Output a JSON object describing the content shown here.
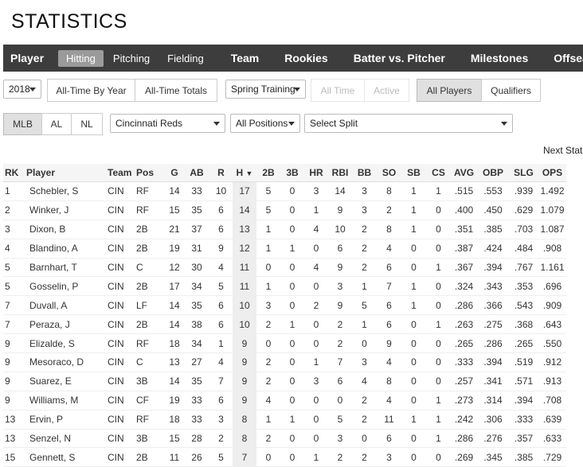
{
  "page": {
    "title": "STATISTICS"
  },
  "nav": {
    "player": "Player",
    "sub": [
      "Hitting",
      "Pitching",
      "Fielding"
    ],
    "main": [
      "Team",
      "Rookies",
      "Batter vs. Pitcher",
      "Milestones",
      "Offseason"
    ]
  },
  "filters": {
    "year": "2018",
    "all_time_by_year": "All-Time By Year",
    "all_time_totals": "All-Time Totals",
    "game_type": "Spring Training",
    "all_time": "All Time",
    "active": "Active",
    "all_players": "All Players",
    "qualifiers": "Qualifiers",
    "leagues": [
      "MLB",
      "AL",
      "NL"
    ],
    "team": "Cincinnati Reds",
    "position": "All Positions",
    "split": "Select Split"
  },
  "next_stats": "Next Stats",
  "table": {
    "columns": [
      "RK",
      "Player",
      "Team",
      "Pos",
      "G",
      "AB",
      "R",
      "H",
      "2B",
      "3B",
      "HR",
      "RBI",
      "BB",
      "SO",
      "SB",
      "CS",
      "AVG",
      "OBP",
      "SLG",
      "OPS"
    ],
    "sort_indicator": "▼",
    "rows": [
      [
        "1",
        "Schebler, S",
        "CIN",
        "RF",
        "14",
        "33",
        "10",
        "17",
        "5",
        "0",
        "3",
        "14",
        "3",
        "8",
        "1",
        "1",
        ".515",
        ".553",
        ".939",
        "1.492"
      ],
      [
        "2",
        "Winker, J",
        "CIN",
        "RF",
        "15",
        "35",
        "6",
        "14",
        "5",
        "0",
        "1",
        "9",
        "3",
        "2",
        "1",
        "0",
        ".400",
        ".450",
        ".629",
        "1.079"
      ],
      [
        "3",
        "Dixon, B",
        "CIN",
        "2B",
        "21",
        "37",
        "6",
        "13",
        "1",
        "0",
        "4",
        "10",
        "2",
        "8",
        "1",
        "0",
        ".351",
        ".385",
        ".703",
        "1.087"
      ],
      [
        "4",
        "Blandino, A",
        "CIN",
        "2B",
        "19",
        "31",
        "9",
        "12",
        "1",
        "1",
        "0",
        "6",
        "2",
        "4",
        "0",
        "0",
        ".387",
        ".424",
        ".484",
        ".908"
      ],
      [
        "5",
        "Barnhart, T",
        "CIN",
        "C",
        "12",
        "30",
        "4",
        "11",
        "0",
        "0",
        "4",
        "9",
        "2",
        "6",
        "0",
        "1",
        ".367",
        ".394",
        ".767",
        "1.161"
      ],
      [
        "5",
        "Gosselin, P",
        "CIN",
        "2B",
        "17",
        "34",
        "5",
        "11",
        "1",
        "0",
        "0",
        "3",
        "1",
        "7",
        "1",
        "0",
        ".324",
        ".343",
        ".353",
        ".696"
      ],
      [
        "7",
        "Duvall, A",
        "CIN",
        "LF",
        "14",
        "35",
        "6",
        "10",
        "3",
        "0",
        "2",
        "9",
        "5",
        "6",
        "1",
        "0",
        ".286",
        ".366",
        ".543",
        ".909"
      ],
      [
        "7",
        "Peraza, J",
        "CIN",
        "2B",
        "14",
        "38",
        "6",
        "10",
        "2",
        "1",
        "0",
        "2",
        "1",
        "6",
        "0",
        "1",
        ".263",
        ".275",
        ".368",
        ".643"
      ],
      [
        "9",
        "Elizalde, S",
        "CIN",
        "RF",
        "18",
        "34",
        "1",
        "9",
        "0",
        "0",
        "0",
        "2",
        "0",
        "9",
        "0",
        "0",
        ".265",
        ".286",
        ".265",
        ".550"
      ],
      [
        "9",
        "Mesoraco, D",
        "CIN",
        "C",
        "13",
        "27",
        "4",
        "9",
        "2",
        "0",
        "1",
        "7",
        "3",
        "4",
        "0",
        "0",
        ".333",
        ".394",
        ".519",
        ".912"
      ],
      [
        "9",
        "Suarez, E",
        "CIN",
        "3B",
        "14",
        "35",
        "7",
        "9",
        "2",
        "0",
        "3",
        "6",
        "4",
        "8",
        "0",
        "0",
        ".257",
        ".341",
        ".571",
        ".913"
      ],
      [
        "9",
        "Williams, M",
        "CIN",
        "CF",
        "19",
        "33",
        "6",
        "9",
        "4",
        "0",
        "0",
        "0",
        "2",
        "4",
        "0",
        "1",
        ".273",
        ".314",
        ".394",
        ".708"
      ],
      [
        "13",
        "Ervin, P",
        "CIN",
        "RF",
        "18",
        "33",
        "3",
        "8",
        "1",
        "1",
        "0",
        "5",
        "2",
        "11",
        "1",
        "1",
        ".242",
        ".306",
        ".333",
        ".639"
      ],
      [
        "13",
        "Senzel, N",
        "CIN",
        "3B",
        "15",
        "28",
        "2",
        "8",
        "2",
        "0",
        "0",
        "3",
        "0",
        "6",
        "0",
        "1",
        ".286",
        ".276",
        ".357",
        ".633"
      ],
      [
        "15",
        "Gennett, S",
        "CIN",
        "2B",
        "11",
        "26",
        "5",
        "7",
        "0",
        "0",
        "1",
        "2",
        "2",
        "3",
        "0",
        "0",
        ".269",
        ".345",
        ".385",
        ".729"
      ]
    ]
  }
}
